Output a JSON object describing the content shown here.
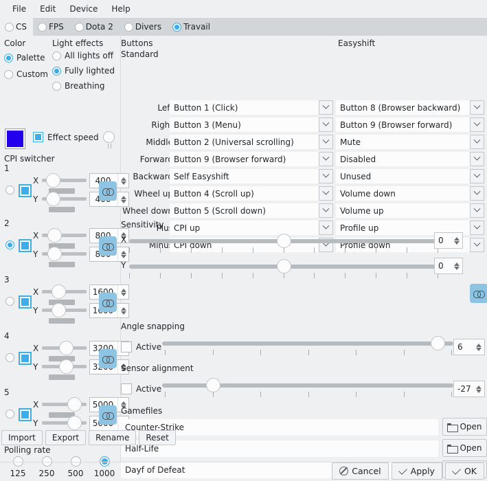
{
  "menubar": {
    "items": [
      "File",
      "Edit",
      "Device",
      "Help"
    ]
  },
  "profile_tabs": [
    {
      "label": "CS",
      "selected": false,
      "active": true
    },
    {
      "label": "FPS",
      "selected": false,
      "active": false
    },
    {
      "label": "Dota 2",
      "selected": false,
      "active": false
    },
    {
      "label": "Divers",
      "selected": false,
      "active": false
    },
    {
      "label": "Travail",
      "selected": true,
      "active": false
    }
  ],
  "color": {
    "group_label": "Color",
    "options": [
      {
        "label": "Palette",
        "selected": true
      },
      {
        "label": "Custom",
        "selected": false
      }
    ],
    "swatch_hex": "#2200ee"
  },
  "light_effects": {
    "group_label": "Light effects",
    "options": [
      {
        "label": "All lights off",
        "selected": false
      },
      {
        "label": "Fully lighted",
        "selected": true
      },
      {
        "label": "Breathing",
        "selected": false
      }
    ],
    "effect_speed_label": "Effect speed",
    "effect_speed_checked": true
  },
  "cpi_switcher": {
    "label": "CPI switcher",
    "rows": [
      {
        "index": "1",
        "selected": false,
        "enabled": true,
        "x": "400",
        "y": "400",
        "x_pct": 4,
        "y_pct": 4
      },
      {
        "index": "2",
        "selected": true,
        "enabled": true,
        "x": "800",
        "y": "800",
        "x_pct": 10,
        "y_pct": 10
      },
      {
        "index": "3",
        "selected": false,
        "enabled": true,
        "x": "1600",
        "y": "1600",
        "x_pct": 24,
        "y_pct": 24
      },
      {
        "index": "4",
        "selected": false,
        "enabled": true,
        "x": "3200",
        "y": "3200",
        "x_pct": 52,
        "y_pct": 52
      },
      {
        "index": "5",
        "selected": false,
        "enabled": true,
        "x": "5000",
        "y": "5000",
        "x_pct": 82,
        "y_pct": 82
      }
    ]
  },
  "polling_rate": {
    "label": "Polling rate",
    "options": [
      {
        "label": "125",
        "selected": false
      },
      {
        "label": "250",
        "selected": false
      },
      {
        "label": "500",
        "selected": false
      },
      {
        "label": "1000",
        "selected": true
      }
    ]
  },
  "buttons": {
    "group_label": "Buttons",
    "col_standard": "Standard",
    "col_easyshift": "Easyshift",
    "rows": [
      {
        "name": "Left",
        "standard": "Button 1 (Click)",
        "easyshift": "Button 8 (Browser backward)"
      },
      {
        "name": "Right",
        "standard": "Button 3 (Menu)",
        "easyshift": "Button 9 (Browser forward)"
      },
      {
        "name": "Middle",
        "standard": "Button 2 (Universal scrolling)",
        "easyshift": "Mute"
      },
      {
        "name": "Forward",
        "standard": "Button 9 (Browser forward)",
        "easyshift": "Disabled"
      },
      {
        "name": "Backward",
        "standard": "Self Easyshift",
        "easyshift": "Unused"
      },
      {
        "name": "Wheel up",
        "standard": "Button 4 (Scroll up)",
        "easyshift": "Volume down"
      },
      {
        "name": "Wheel down",
        "standard": "Button 5 (Scroll down)",
        "easyshift": "Volume up"
      },
      {
        "name": "Plus",
        "standard": "CPI up",
        "easyshift": "Profile up"
      },
      {
        "name": "Minus",
        "standard": "CPI down",
        "easyshift": "Profile down"
      }
    ]
  },
  "sensitivity": {
    "label": "Sensitivity",
    "x": {
      "axis": "X",
      "value": "0",
      "pct": 50
    },
    "y": {
      "axis": "Y",
      "value": "0",
      "pct": 50
    }
  },
  "angle_snapping": {
    "label": "Angle snapping",
    "active_label": "Active",
    "active": false,
    "value": "6",
    "pct": 97
  },
  "sensor_alignment": {
    "label": "Sensor alignment",
    "active_label": "Active",
    "active": false,
    "value": "-27",
    "pct": 16
  },
  "gamefiles": {
    "label": "Gamefiles",
    "open_label": "Open",
    "rows": [
      {
        "name": "Counter-Strike"
      },
      {
        "name": "Half-Life"
      },
      {
        "name": "Dayf of Defeat"
      }
    ]
  },
  "profile_buttons": [
    "Import",
    "Export",
    "Rename",
    "Reset"
  ],
  "dialog_buttons": [
    {
      "label": "Cancel",
      "icon": "cancel-icon"
    },
    {
      "label": "Apply",
      "icon": "check-icon"
    },
    {
      "label": "OK",
      "icon": "check-icon"
    }
  ],
  "theme": {
    "accent": "#3daee9",
    "window_bg": "#eff0f1",
    "field_bg": "#fcfcfc"
  }
}
